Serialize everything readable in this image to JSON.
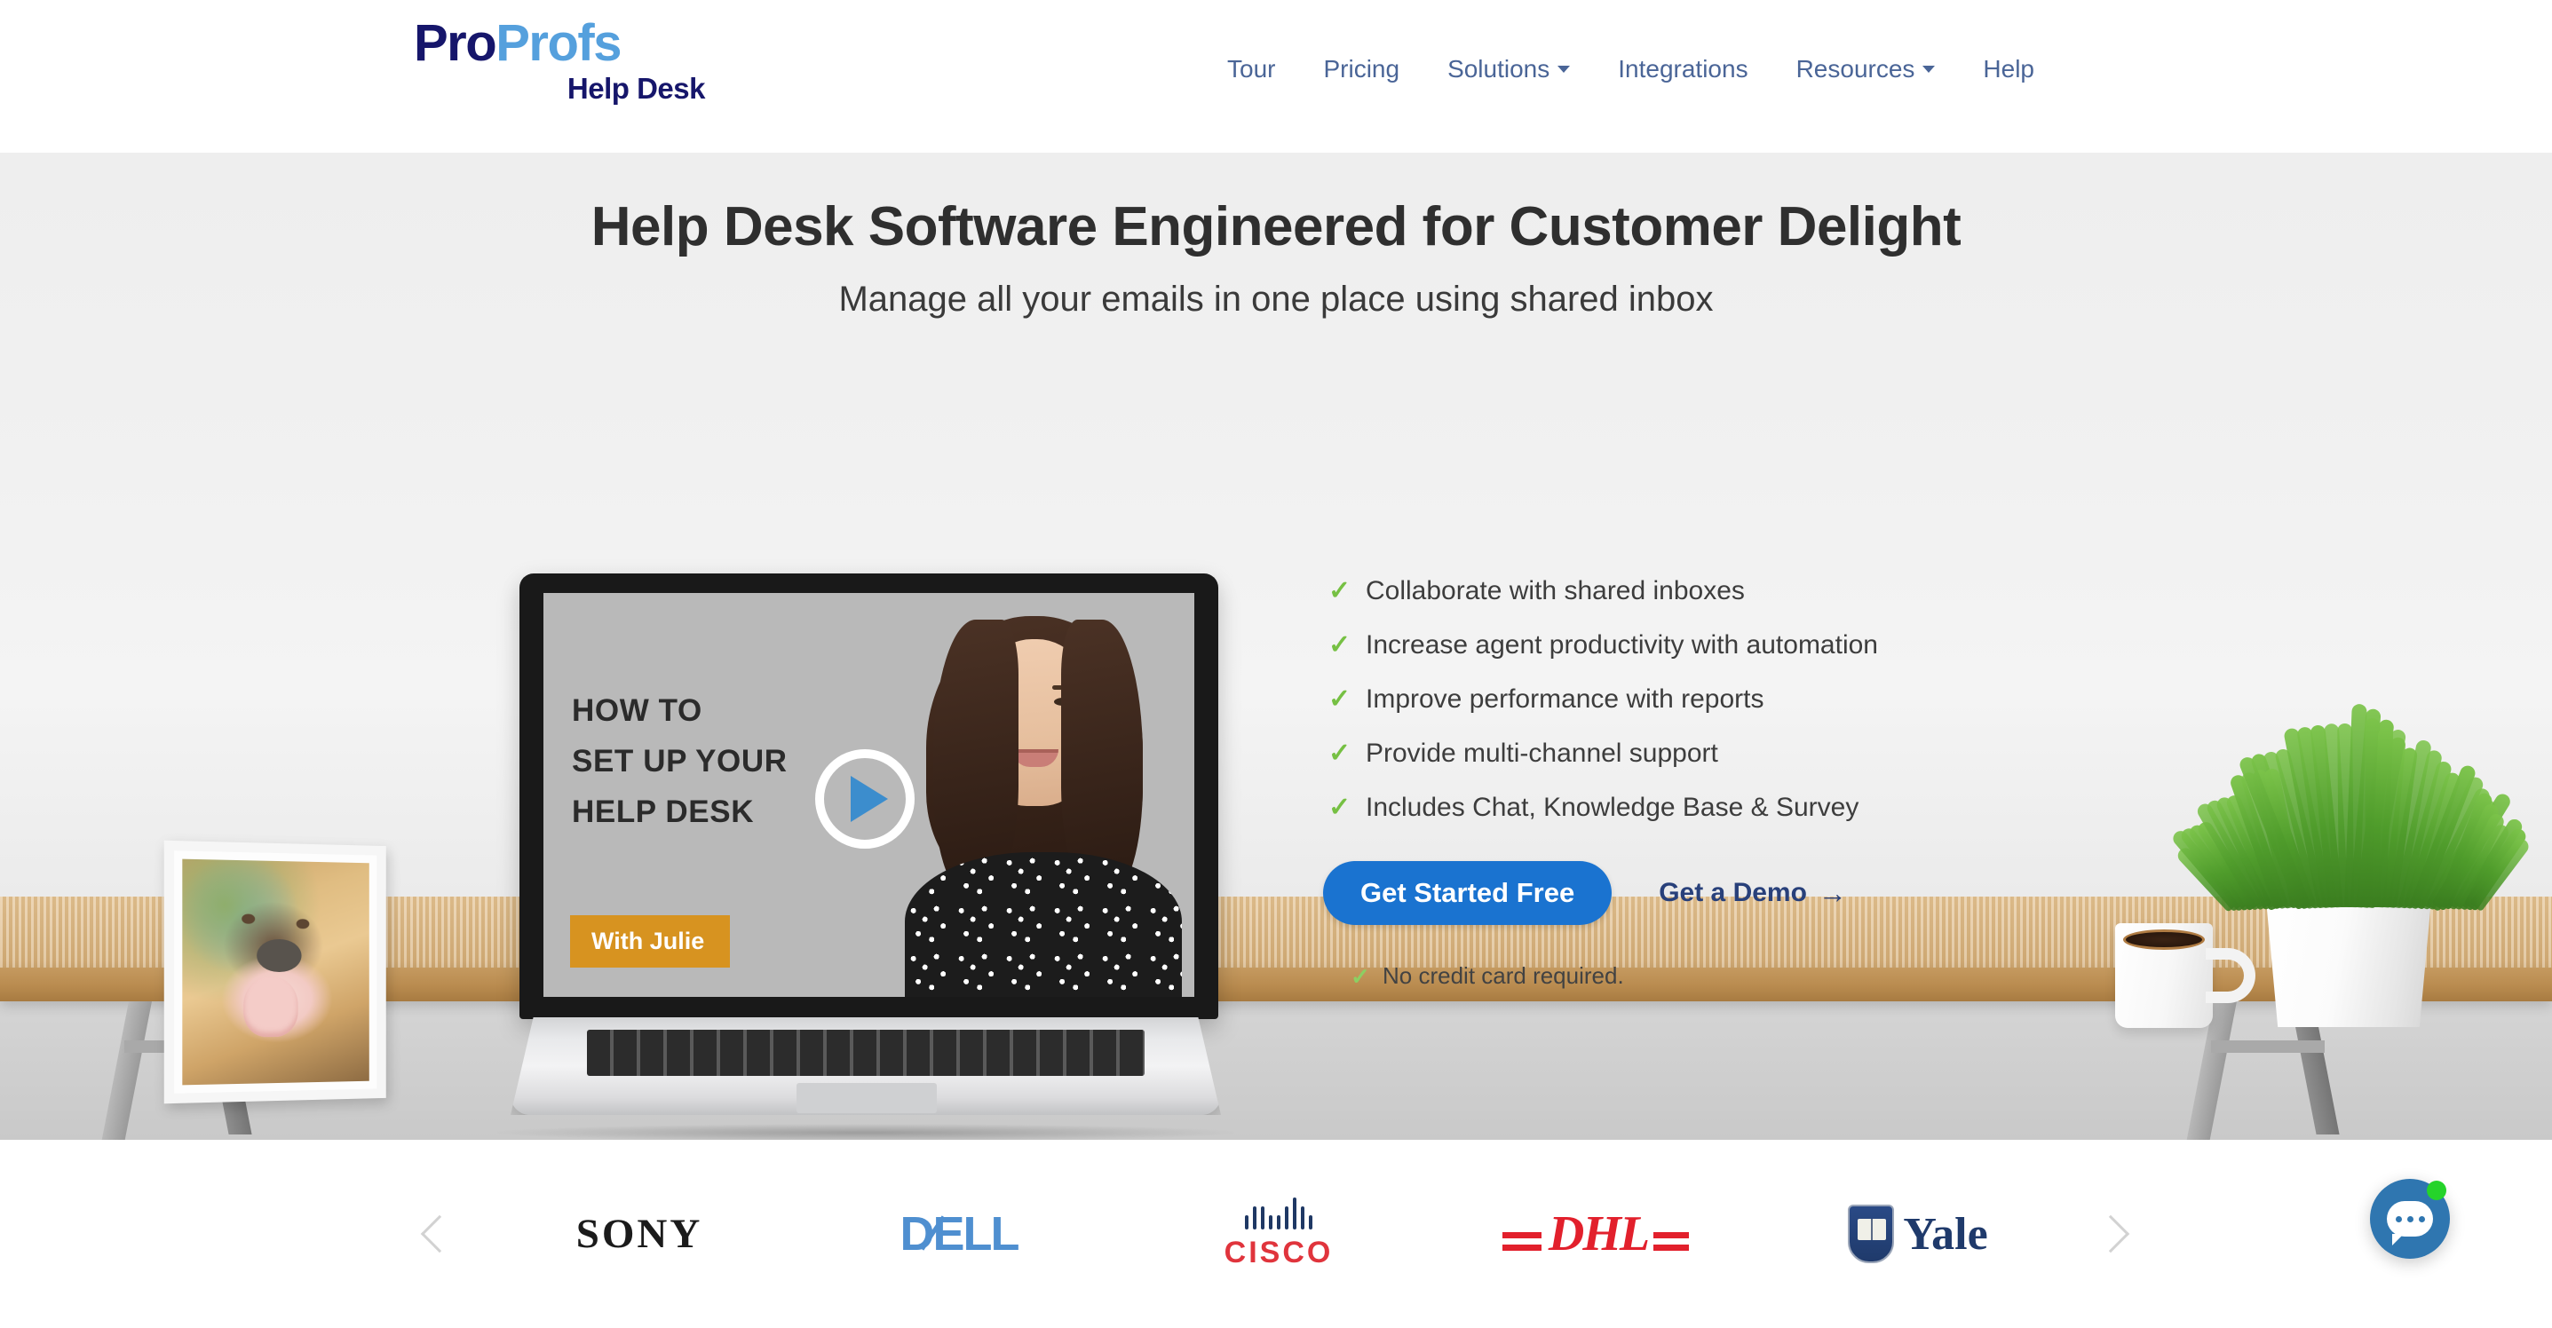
{
  "header": {
    "logo": {
      "part1": "Pro",
      "part2": "Profs",
      "subtitle": "Help Desk",
      "color_part1": "#16166b",
      "color_part2": "#55a0dd"
    },
    "nav": [
      {
        "label": "Tour",
        "has_dropdown": false
      },
      {
        "label": "Pricing",
        "has_dropdown": false
      },
      {
        "label": "Solutions",
        "has_dropdown": true
      },
      {
        "label": "Integrations",
        "has_dropdown": false
      },
      {
        "label": "Resources",
        "has_dropdown": true
      },
      {
        "label": "Help",
        "has_dropdown": false
      }
    ],
    "nav_color": "#4a6597"
  },
  "hero": {
    "title": "Help Desk Software Engineered for Customer Delight",
    "subtitle": "Manage all your emails in one place using shared inbox",
    "video": {
      "line1": "HOW TO",
      "line2": "SET UP YOUR",
      "line3": "HELP DESK",
      "badge": "With Julie",
      "badge_color": "#d79320",
      "play_color": "#3c8dcd"
    },
    "features": [
      "Collaborate with shared inboxes",
      "Increase agent productivity with automation",
      "Improve performance with reports",
      "Provide multi-channel support",
      "Includes Chat, Knowledge Base & Survey"
    ],
    "check_color": "#76c043",
    "cta": {
      "primary_label": "Get Started Free",
      "primary_color": "#1a73d0",
      "secondary_label": "Get a Demo",
      "secondary_arrow": "→",
      "secondary_color": "#28407a",
      "note": "No credit card required."
    }
  },
  "carousel": {
    "prev_icon": "chevron-left-icon",
    "next_icon": "chevron-right-icon",
    "logos": [
      {
        "name": "SONY",
        "color": "#1b1b1b"
      },
      {
        "name": "DELL",
        "color": "#4f8fd0"
      },
      {
        "name": "CISCO",
        "color": "#e0343c"
      },
      {
        "name": "DHL",
        "color": "#e2202c"
      },
      {
        "name": "Yale",
        "color": "#1f3a6b"
      }
    ]
  },
  "chat": {
    "icon": "chat-bubble-icon",
    "color": "#2f76b0",
    "online_color": "#25d32a"
  }
}
